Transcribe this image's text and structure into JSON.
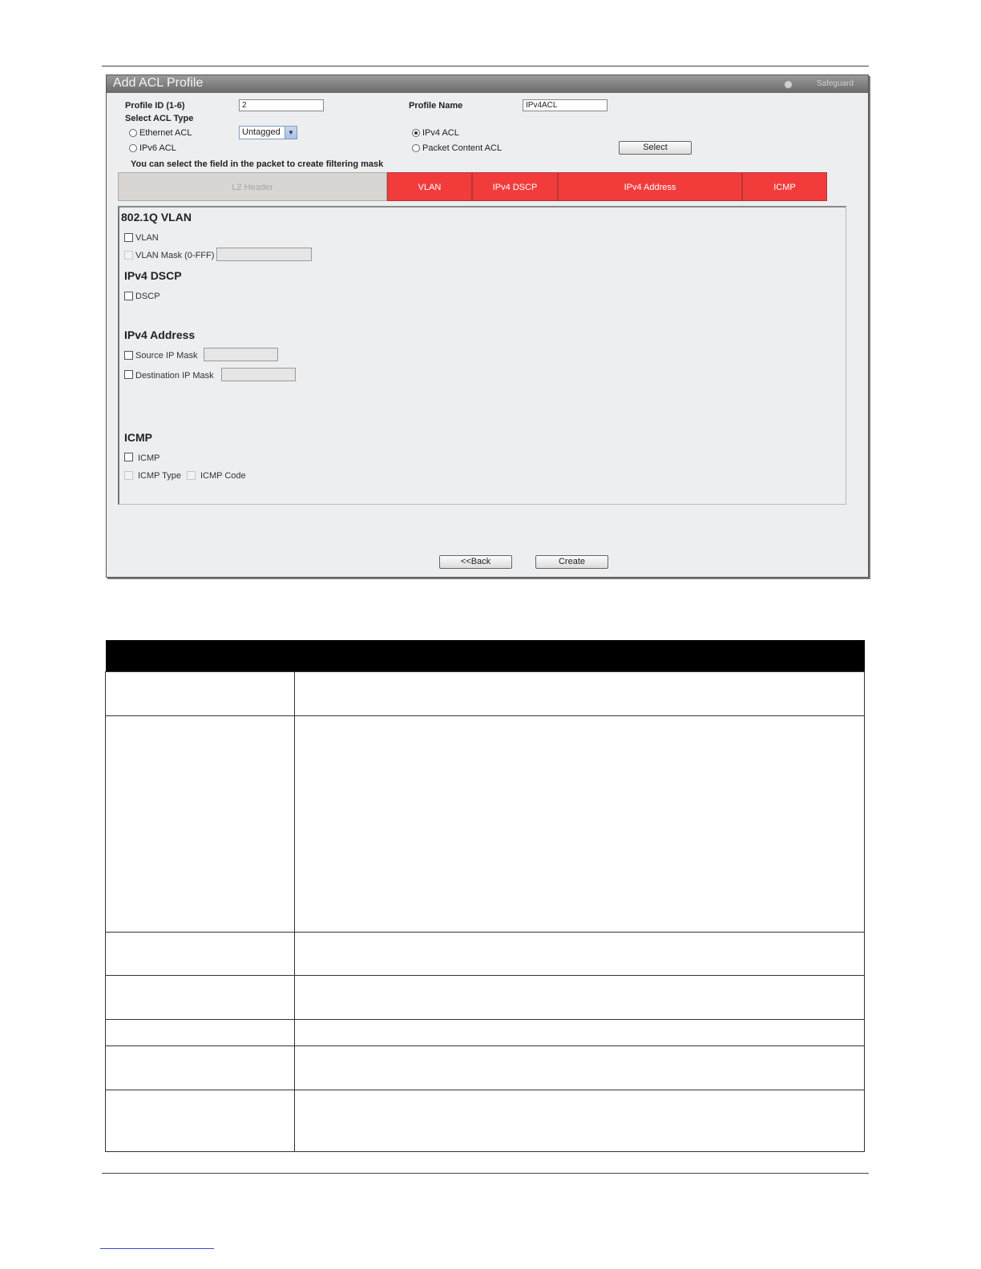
{
  "window": {
    "title": "Add ACL Profile",
    "safeguard_label": "Safeguard"
  },
  "form": {
    "profile_id_label": "Profile ID (1-6)",
    "profile_id_value": "2",
    "profile_name_label": "Profile Name",
    "profile_name_value": "IPv4ACL",
    "select_acl_type_label": "Select ACL Type",
    "acl_types": {
      "ethernet": "Ethernet ACL",
      "ipv6": "IPv6 ACL",
      "ipv4": "IPv4 ACL",
      "packet_content": "Packet Content ACL"
    },
    "selected_acl_type": "IPv4 ACL",
    "vlan_tag_select": "Untagged",
    "select_button": "Select",
    "hint": "You can select the field in the packet to create filtering mask"
  },
  "tabs": [
    {
      "label": "L2 Header",
      "active": false
    },
    {
      "label": "VLAN",
      "active": true
    },
    {
      "label": "IPv4 DSCP",
      "active": true
    },
    {
      "label": "IPv4 Address",
      "active": true
    },
    {
      "label": "ICMP",
      "active": true
    }
  ],
  "sections": {
    "vlan": {
      "title": "802.1Q VLAN",
      "vlan_label": "VLAN",
      "vlan_mask_label": "VLAN Mask (0-FFF)"
    },
    "dscp": {
      "title": "IPv4 DSCP",
      "dscp_label": "DSCP"
    },
    "address": {
      "title": "IPv4 Address",
      "source_ip_mask_label": "Source IP Mask",
      "destination_ip_mask_label": "Destination IP Mask"
    },
    "icmp": {
      "title": "ICMP",
      "icmp_label": "ICMP",
      "icmp_type_label": "ICMP Type",
      "icmp_code_label": "ICMP Code"
    }
  },
  "actions": {
    "back_label": "<<Back",
    "create_label": "Create"
  }
}
